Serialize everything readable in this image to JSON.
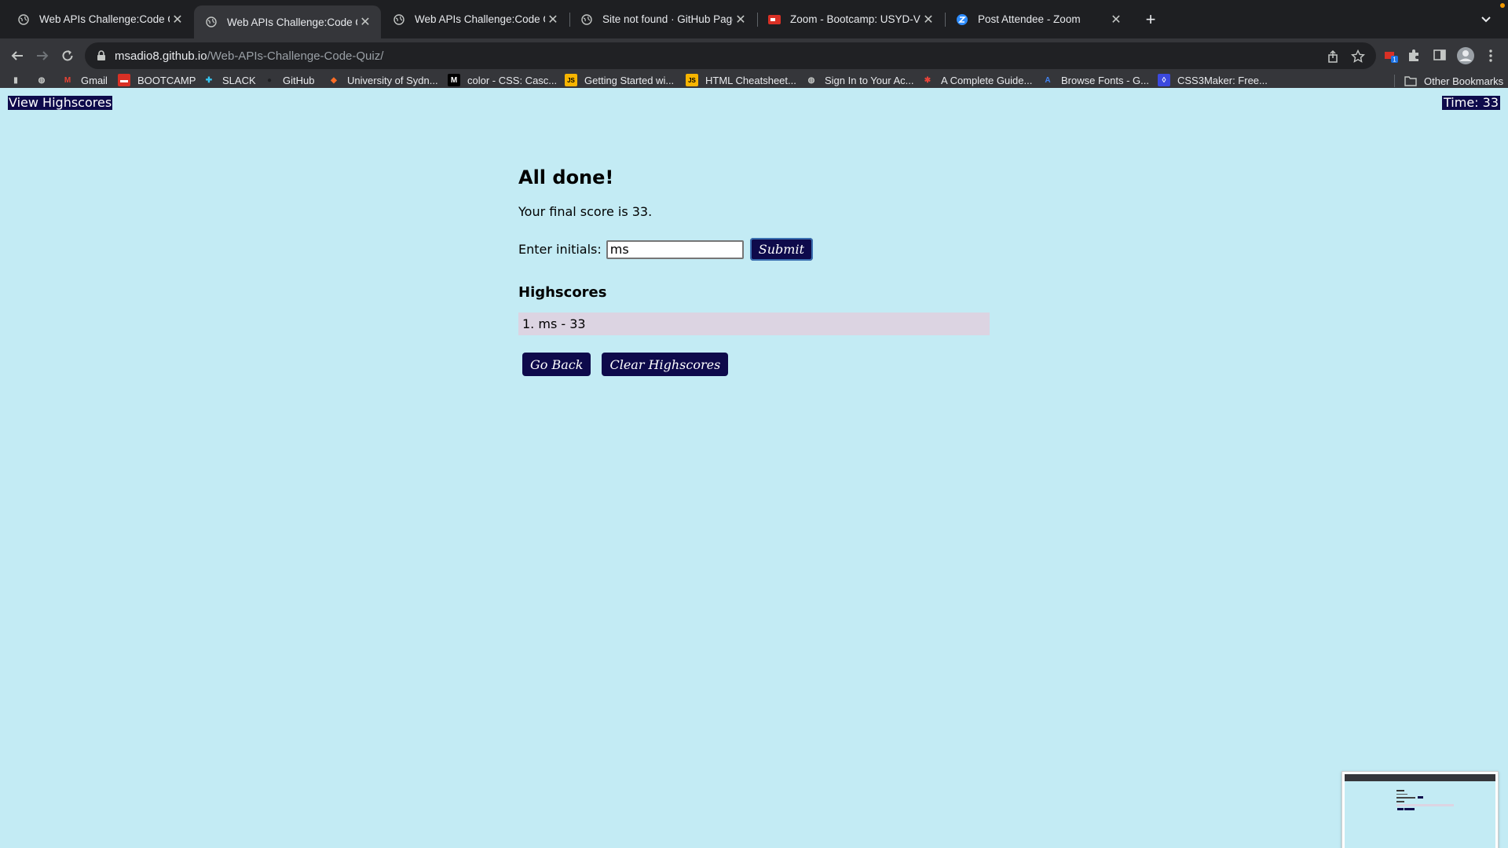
{
  "browser": {
    "tabs": [
      {
        "title": "Web APIs Challenge:Code Quiz",
        "active": false,
        "favicon": "globe-icon"
      },
      {
        "title": "Web APIs Challenge:Code Quiz",
        "active": true,
        "favicon": "globe-icon"
      },
      {
        "title": "Web APIs Challenge:Code Quiz",
        "active": false,
        "favicon": "globe-icon"
      },
      {
        "title": "Site not found · GitHub Pages",
        "active": false,
        "favicon": "globe-icon"
      },
      {
        "title": "Zoom - Bootcamp: USYD-VIRT",
        "active": false,
        "favicon": "zoom-icon"
      },
      {
        "title": "Post Attendee - Zoom",
        "active": false,
        "favicon": "zoom-z-icon"
      }
    ],
    "url_host": "msadio8.github.io",
    "url_path": "/Web-APIs-Challenge-Code-Quiz/",
    "bookmarks": [
      {
        "label": "",
        "icon": "tab-icon"
      },
      {
        "label": "",
        "icon": "globe-icon"
      },
      {
        "label": "Gmail",
        "icon": "gmail-icon"
      },
      {
        "label": "BOOTCAMP",
        "icon": "bootcamp-icon"
      },
      {
        "label": "SLACK",
        "icon": "slack-icon"
      },
      {
        "label": "GitHub",
        "icon": "github-icon"
      },
      {
        "label": "University of Sydn...",
        "icon": "gitlab-icon"
      },
      {
        "label": "color - CSS: Casc...",
        "icon": "mdn-icon"
      },
      {
        "label": "Getting Started wi...",
        "icon": "js-icon"
      },
      {
        "label": "HTML Cheatsheet...",
        "icon": "js-icon"
      },
      {
        "label": "Sign In to Your Ac...",
        "icon": "globe-icon"
      },
      {
        "label": "A Complete Guide...",
        "icon": "star-icon"
      },
      {
        "label": "Browse Fonts - G...",
        "icon": "fonts-icon"
      },
      {
        "label": "CSS3Maker: Free...",
        "icon": "css3maker-icon"
      }
    ],
    "other_bookmarks": "Other Bookmarks"
  },
  "header": {
    "view_highscores": "View Highscores",
    "timer": "Time: 33"
  },
  "quiz": {
    "title": "All done!",
    "final_score_text": "Your final score is 33.",
    "initials_label": "Enter initials:",
    "initials_value": "ms",
    "submit_label": "Submit",
    "highscores_title": "Highscores",
    "highscores": [
      "1. ms - 33"
    ],
    "go_back_label": "Go Back",
    "clear_label": "Clear Highscores"
  },
  "colors": {
    "page_bg": "#c3ebf4",
    "button_bg": "#0e0a4b",
    "highscore_row_bg": "#dcd4e2"
  }
}
